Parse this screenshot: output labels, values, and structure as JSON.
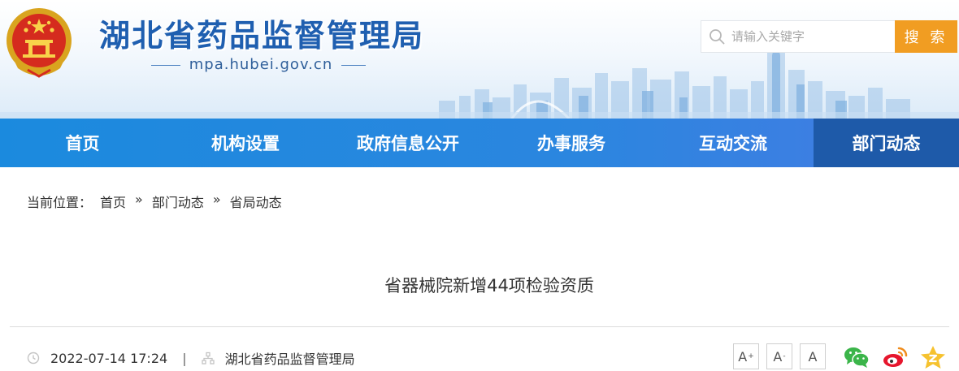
{
  "header": {
    "site_title": "湖北省药品监督管理局",
    "domain": "mpa.hubei.gov.cn"
  },
  "search": {
    "placeholder": "请输入关键字",
    "button_label": "搜 索"
  },
  "nav": {
    "items": [
      {
        "label": "首页"
      },
      {
        "label": "机构设置"
      },
      {
        "label": "政府信息公开"
      },
      {
        "label": "办事服务"
      },
      {
        "label": "互动交流"
      },
      {
        "label": "部门动态",
        "active": true
      }
    ]
  },
  "breadcrumb": {
    "prefix": "当前位置：",
    "separator": "»",
    "items": [
      "首页",
      "部门动态",
      "省局动态"
    ]
  },
  "article": {
    "title": "省器械院新增44项检验资质",
    "date": "2022-07-14 17:24",
    "divider": "|",
    "source": "湖北省药品监督管理局"
  },
  "font_size": {
    "large": "A",
    "medium": "A",
    "normal": "A"
  },
  "colors": {
    "brand": "#1f5fb0",
    "nav": "#2b86df",
    "nav_active": "#1e5aa9",
    "search_button": "#f19d22"
  },
  "icons": [
    "search-icon",
    "clock-icon",
    "source-icon",
    "wechat-icon",
    "weibo-icon",
    "qzone-icon"
  ]
}
